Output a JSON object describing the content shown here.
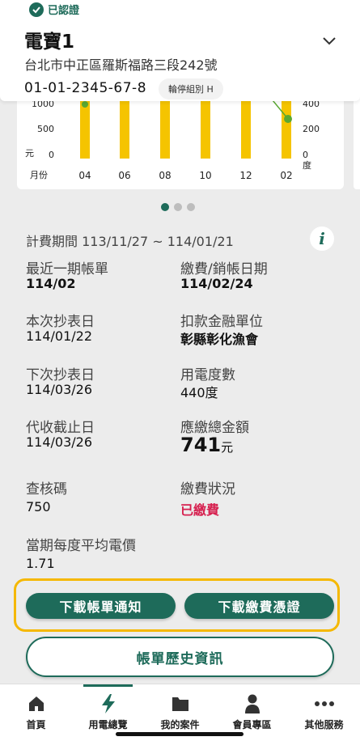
{
  "header": {
    "verified_label": "已認證",
    "account_name": "電寶1",
    "address": "台北市中正區羅斯福路三段242號",
    "account_number": "01-01-2345-67-8",
    "group_badge": "輪停組別 H"
  },
  "chart_data": {
    "type": "bar",
    "title": "",
    "xlabel": "月份",
    "ylabel": "元",
    "y2label": "度",
    "categories": [
      "04",
      "06",
      "08",
      "10",
      "12",
      "02"
    ],
    "y_ticks": [
      "1000",
      "500",
      "0"
    ],
    "y2_ticks": [
      "400",
      "200",
      "0"
    ],
    "bar_color": "#f5c400",
    "line_color": "#5aa832"
  },
  "carousel": {
    "pages": 3,
    "active": 0
  },
  "billing": {
    "period": "計費期間 113/11/27 ~ 114/01/21",
    "latest_bill_label": "最近一期帳單",
    "latest_bill_value": "114/02",
    "payment_date_label": "繳費/銷帳日期",
    "payment_date_value": "114/02/24",
    "read_date_label": "本次抄表日",
    "read_date_value": "114/01/22",
    "bank_label": "扣款金融單位",
    "bank_value": "彰縣彰化漁會",
    "next_read_label": "下次抄表日",
    "next_read_value": "114/03/26",
    "usage_label": "用電度數",
    "usage_value": "440度",
    "deadline_label": "代收截止日",
    "deadline_value": "114/03/26",
    "total_label": "應繳總金額",
    "total_value": "741",
    "total_unit": "元",
    "check_code_label": "查核碼",
    "check_code_value": "750",
    "status_label": "繳費狀況",
    "status_value": "已繳費",
    "avg_price_label": "當期每度平均電價",
    "avg_price_value": "1.71"
  },
  "actions": {
    "download_bill": "下載帳單通知",
    "download_receipt": "下載繳費憑證",
    "history": "帳單歷史資訊"
  },
  "tabs": [
    {
      "label": "首頁",
      "icon": "home-icon"
    },
    {
      "label": "用電總覽",
      "icon": "lightning-icon"
    },
    {
      "label": "我的案件",
      "icon": "folder-icon"
    },
    {
      "label": "會員專區",
      "icon": "user-icon"
    },
    {
      "label": "其他服務",
      "icon": "more-icon"
    }
  ],
  "colors": {
    "primary": "#1e6b5a",
    "accent_border": "#f5b800",
    "paid": "#d6204f"
  }
}
